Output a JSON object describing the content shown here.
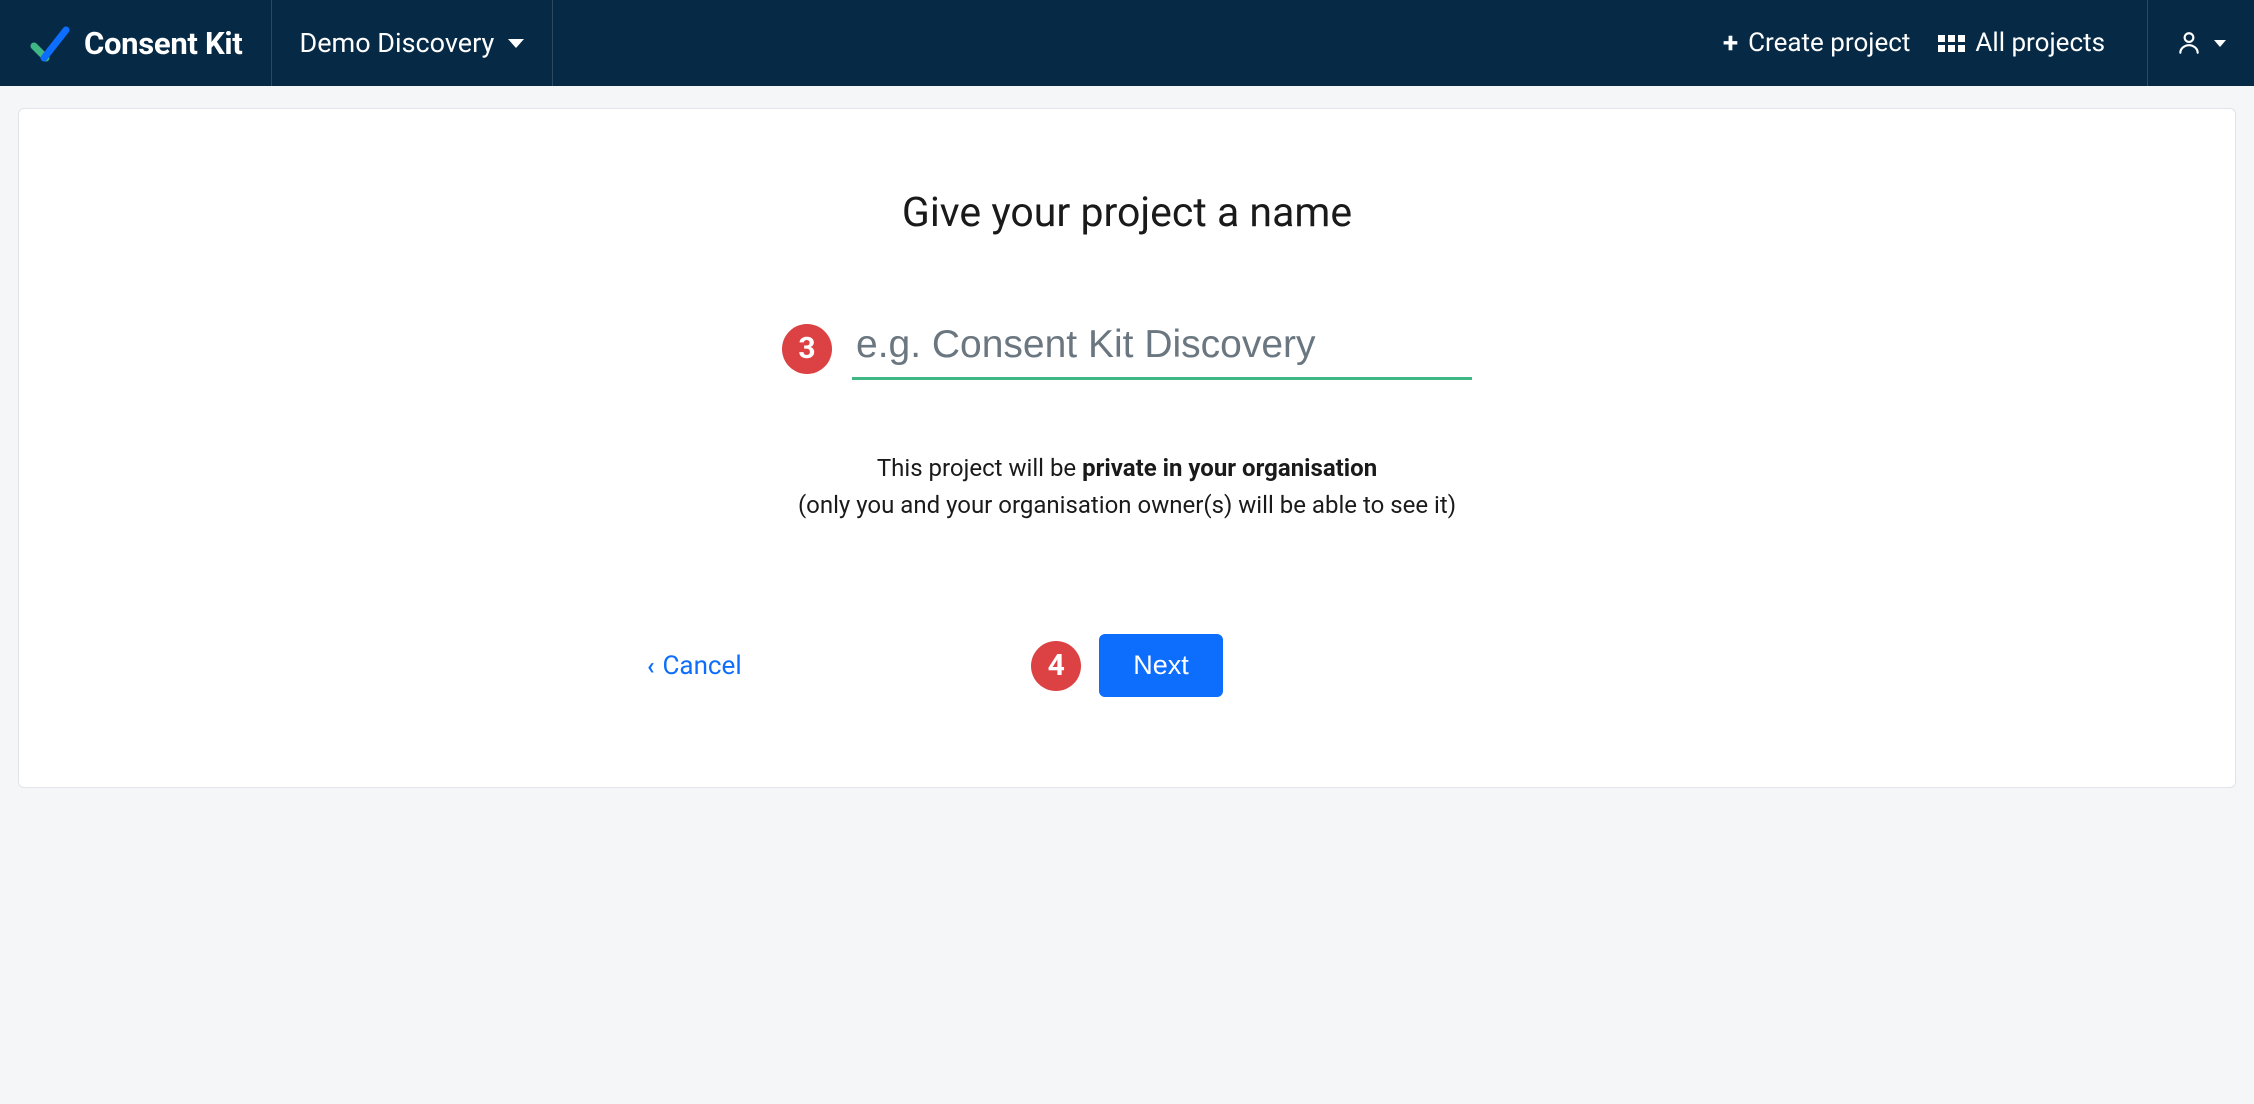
{
  "navbar": {
    "brand": "Consent Kit",
    "project_selector": "Demo Discovery",
    "create_label": "Create project",
    "all_projects_label": "All projects"
  },
  "main": {
    "title": "Give your project a name",
    "name_placeholder": "e.g. Consent Kit Discovery",
    "helper_line1_pre": "This project will be ",
    "helper_line1_bold": "private in your organisation",
    "helper_line2": "(only you and your organisation owner(s) will be able to see it)",
    "cancel_label": "Cancel",
    "next_label": "Next"
  },
  "annotations": {
    "step_input": "3",
    "step_next": "4"
  }
}
